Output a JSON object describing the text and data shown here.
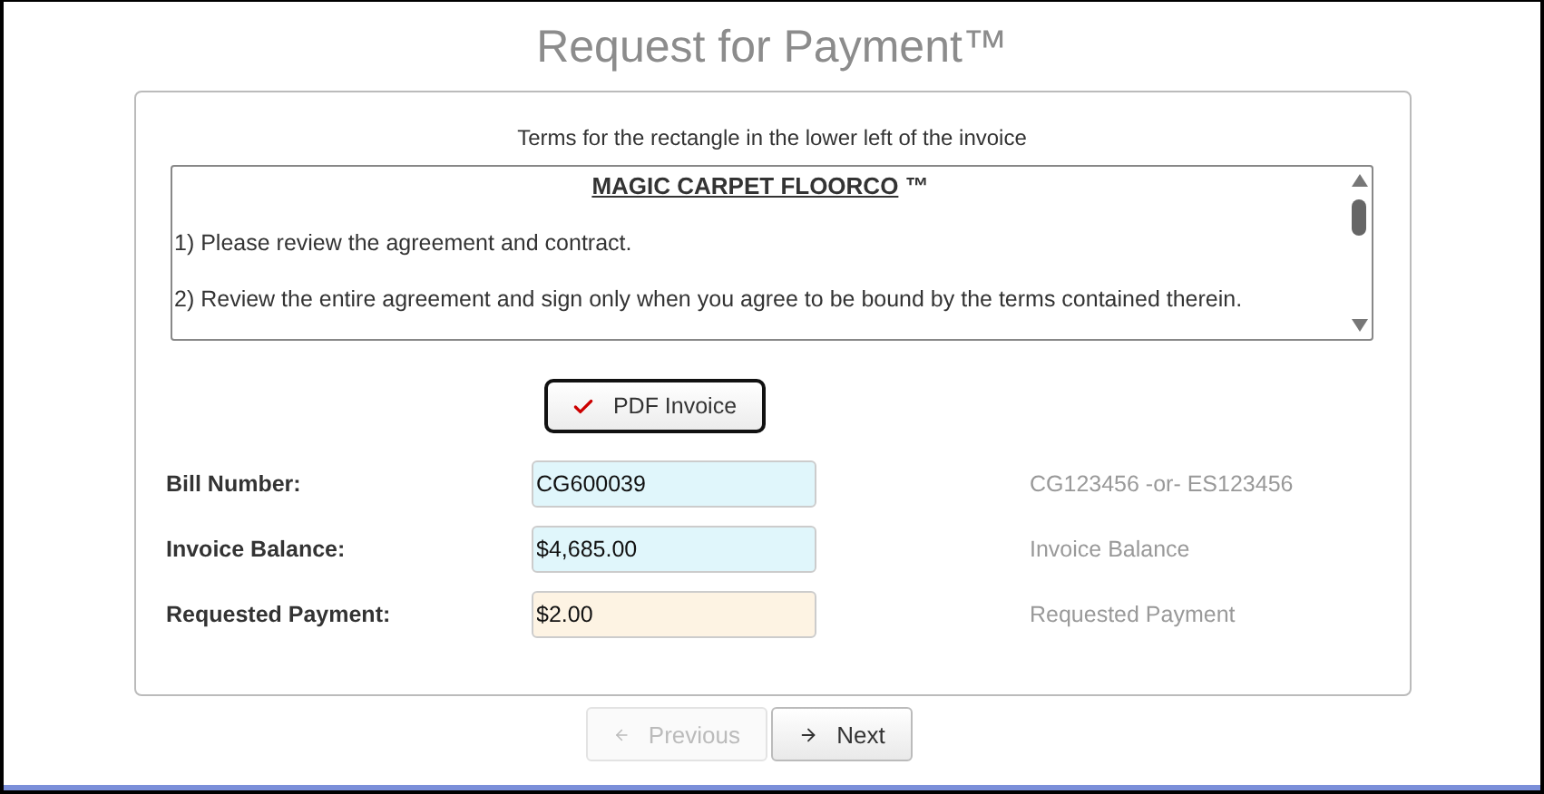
{
  "title": "Request for Payment™",
  "terms": {
    "caption": "Terms for the rectangle in the lower left of the invoice",
    "heading": "MAGIC CARPET FLOORCO",
    "heading_mark": "™",
    "paragraphs": [
      "1) Please review the agreement and contract.",
      "2) Review the entire agreement and sign only when you agree to be bound by the terms contained therein."
    ]
  },
  "pdf_button": {
    "label": "PDF Invoice"
  },
  "fields": [
    {
      "label": "Bill Number:",
      "value": "CG600039",
      "hint": "CG123456 -or- ES123456",
      "color": "#e0f6fb"
    },
    {
      "label": "Invoice Balance:",
      "value": "$4,685.00",
      "hint": "Invoice Balance",
      "color": "#e0f6fb"
    },
    {
      "label": "Requested Payment:",
      "value": "$2.00",
      "hint": "Requested Payment",
      "color": "#fdf3e3"
    }
  ],
  "nav": [
    {
      "label": "Previous",
      "kind": "back",
      "disabled": true
    },
    {
      "label": "Next",
      "kind": "forward",
      "disabled": false
    }
  ]
}
